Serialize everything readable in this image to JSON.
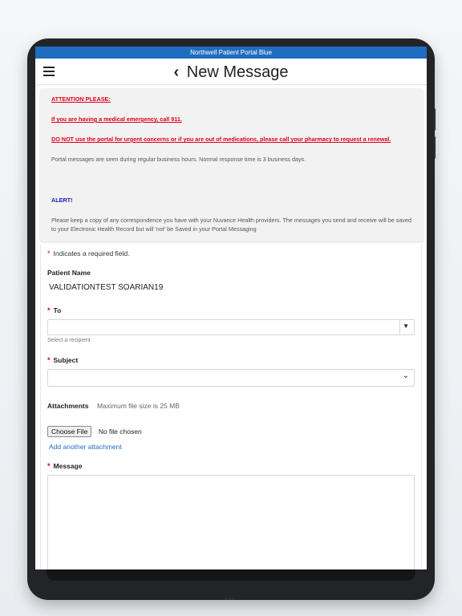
{
  "status_bar": {
    "title": "Northwell Patient Portal Blue"
  },
  "nav": {
    "title": "New Message",
    "back_icon": "chevron-left-icon",
    "menu_icon": "hamburger-icon"
  },
  "notice": {
    "attention": "ATTENTION PLEASE:",
    "emergency": "If you are having a medical emergency, call 911.",
    "urgent": "DO NOT use the portal for urgent concerns or if you are out of medications, please call your pharmacy to request a renewal.",
    "hours": "Portal messages are seen during regular business hours. Normal response time is 3 business days.",
    "alert": "ALERT!",
    "keep_copy": "Please keep a copy of any correspondence you have with your Nuvance Health providers. The messages you send and receive will be saved to your Electronic Health Record but will 'not' be Saved in your Portal Messaging"
  },
  "form": {
    "required_note": "Indicates a required field.",
    "required_star": "*",
    "patient_label": "Patient Name",
    "patient_value": "VALIDATIONTEST SOARIAN19",
    "to_label": "To",
    "to_hint": "Select a recipient",
    "subject_label": "Subject",
    "attachments_label": "Attachments",
    "attachments_note": "Maximum file size is 25 MB",
    "choose_file": "Choose File",
    "no_file": "No file chosen",
    "add_attachment": "Add another attachment",
    "message_label": "Message"
  },
  "colors": {
    "status_bar": "#1f6dc1",
    "required": "#d0021b",
    "link": "#1f6dc1",
    "alert": "#1a1ab8"
  }
}
